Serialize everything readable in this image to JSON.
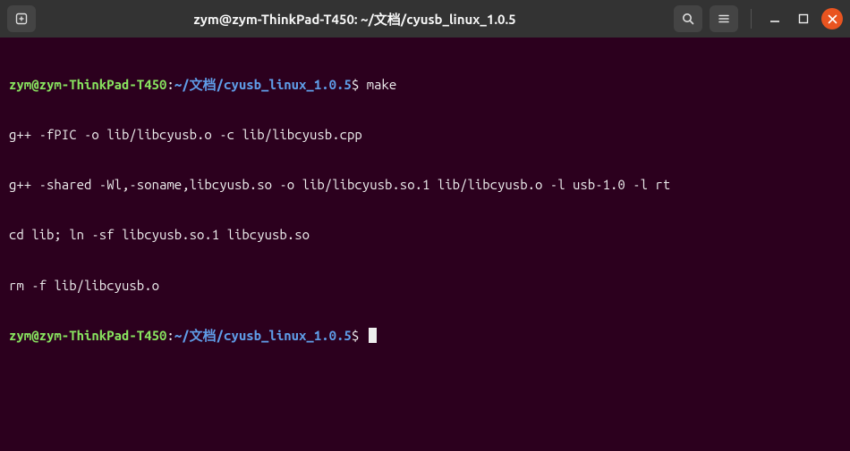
{
  "titlebar": {
    "title": "zym@zym-ThinkPad-T450: ~/文档/cyusb_linux_1.0.5"
  },
  "prompt": {
    "user_host": "zym@zym-ThinkPad-T450",
    "colon": ":",
    "path": "~/文档/cyusb_linux_1.0.5",
    "dollar": "$"
  },
  "lines": [
    {
      "type": "cmd",
      "text": "make"
    },
    {
      "type": "out",
      "text": "g++ -fPIC -o lib/libcyusb.o -c lib/libcyusb.cpp"
    },
    {
      "type": "out",
      "text": "g++ -shared -Wl,-soname,libcyusb.so -o lib/libcyusb.so.1 lib/libcyusb.o -l usb-1.0 -l rt"
    },
    {
      "type": "out",
      "text": "cd lib; ln -sf libcyusb.so.1 libcyusb.so"
    },
    {
      "type": "out",
      "text": "rm -f lib/libcyusb.o"
    },
    {
      "type": "prompt",
      "text": ""
    }
  ]
}
